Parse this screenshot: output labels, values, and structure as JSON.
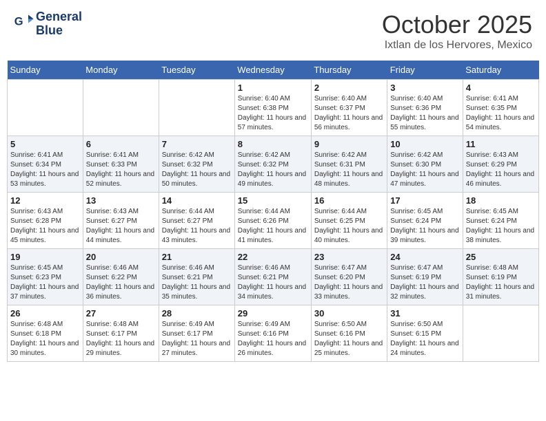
{
  "header": {
    "logo_line1": "General",
    "logo_line2": "Blue",
    "month": "October 2025",
    "location": "Ixtlan de los Hervores, Mexico"
  },
  "days_of_week": [
    "Sunday",
    "Monday",
    "Tuesday",
    "Wednesday",
    "Thursday",
    "Friday",
    "Saturday"
  ],
  "weeks": [
    [
      {
        "day": "",
        "sunrise": "",
        "sunset": "",
        "daylight": ""
      },
      {
        "day": "",
        "sunrise": "",
        "sunset": "",
        "daylight": ""
      },
      {
        "day": "",
        "sunrise": "",
        "sunset": "",
        "daylight": ""
      },
      {
        "day": "1",
        "sunrise": "Sunrise: 6:40 AM",
        "sunset": "Sunset: 6:38 PM",
        "daylight": "Daylight: 11 hours and 57 minutes."
      },
      {
        "day": "2",
        "sunrise": "Sunrise: 6:40 AM",
        "sunset": "Sunset: 6:37 PM",
        "daylight": "Daylight: 11 hours and 56 minutes."
      },
      {
        "day": "3",
        "sunrise": "Sunrise: 6:40 AM",
        "sunset": "Sunset: 6:36 PM",
        "daylight": "Daylight: 11 hours and 55 minutes."
      },
      {
        "day": "4",
        "sunrise": "Sunrise: 6:41 AM",
        "sunset": "Sunset: 6:35 PM",
        "daylight": "Daylight: 11 hours and 54 minutes."
      }
    ],
    [
      {
        "day": "5",
        "sunrise": "Sunrise: 6:41 AM",
        "sunset": "Sunset: 6:34 PM",
        "daylight": "Daylight: 11 hours and 53 minutes."
      },
      {
        "day": "6",
        "sunrise": "Sunrise: 6:41 AM",
        "sunset": "Sunset: 6:33 PM",
        "daylight": "Daylight: 11 hours and 52 minutes."
      },
      {
        "day": "7",
        "sunrise": "Sunrise: 6:42 AM",
        "sunset": "Sunset: 6:32 PM",
        "daylight": "Daylight: 11 hours and 50 minutes."
      },
      {
        "day": "8",
        "sunrise": "Sunrise: 6:42 AM",
        "sunset": "Sunset: 6:32 PM",
        "daylight": "Daylight: 11 hours and 49 minutes."
      },
      {
        "day": "9",
        "sunrise": "Sunrise: 6:42 AM",
        "sunset": "Sunset: 6:31 PM",
        "daylight": "Daylight: 11 hours and 48 minutes."
      },
      {
        "day": "10",
        "sunrise": "Sunrise: 6:42 AM",
        "sunset": "Sunset: 6:30 PM",
        "daylight": "Daylight: 11 hours and 47 minutes."
      },
      {
        "day": "11",
        "sunrise": "Sunrise: 6:43 AM",
        "sunset": "Sunset: 6:29 PM",
        "daylight": "Daylight: 11 hours and 46 minutes."
      }
    ],
    [
      {
        "day": "12",
        "sunrise": "Sunrise: 6:43 AM",
        "sunset": "Sunset: 6:28 PM",
        "daylight": "Daylight: 11 hours and 45 minutes."
      },
      {
        "day": "13",
        "sunrise": "Sunrise: 6:43 AM",
        "sunset": "Sunset: 6:27 PM",
        "daylight": "Daylight: 11 hours and 44 minutes."
      },
      {
        "day": "14",
        "sunrise": "Sunrise: 6:44 AM",
        "sunset": "Sunset: 6:27 PM",
        "daylight": "Daylight: 11 hours and 43 minutes."
      },
      {
        "day": "15",
        "sunrise": "Sunrise: 6:44 AM",
        "sunset": "Sunset: 6:26 PM",
        "daylight": "Daylight: 11 hours and 41 minutes."
      },
      {
        "day": "16",
        "sunrise": "Sunrise: 6:44 AM",
        "sunset": "Sunset: 6:25 PM",
        "daylight": "Daylight: 11 hours and 40 minutes."
      },
      {
        "day": "17",
        "sunrise": "Sunrise: 6:45 AM",
        "sunset": "Sunset: 6:24 PM",
        "daylight": "Daylight: 11 hours and 39 minutes."
      },
      {
        "day": "18",
        "sunrise": "Sunrise: 6:45 AM",
        "sunset": "Sunset: 6:24 PM",
        "daylight": "Daylight: 11 hours and 38 minutes."
      }
    ],
    [
      {
        "day": "19",
        "sunrise": "Sunrise: 6:45 AM",
        "sunset": "Sunset: 6:23 PM",
        "daylight": "Daylight: 11 hours and 37 minutes."
      },
      {
        "day": "20",
        "sunrise": "Sunrise: 6:46 AM",
        "sunset": "Sunset: 6:22 PM",
        "daylight": "Daylight: 11 hours and 36 minutes."
      },
      {
        "day": "21",
        "sunrise": "Sunrise: 6:46 AM",
        "sunset": "Sunset: 6:21 PM",
        "daylight": "Daylight: 11 hours and 35 minutes."
      },
      {
        "day": "22",
        "sunrise": "Sunrise: 6:46 AM",
        "sunset": "Sunset: 6:21 PM",
        "daylight": "Daylight: 11 hours and 34 minutes."
      },
      {
        "day": "23",
        "sunrise": "Sunrise: 6:47 AM",
        "sunset": "Sunset: 6:20 PM",
        "daylight": "Daylight: 11 hours and 33 minutes."
      },
      {
        "day": "24",
        "sunrise": "Sunrise: 6:47 AM",
        "sunset": "Sunset: 6:19 PM",
        "daylight": "Daylight: 11 hours and 32 minutes."
      },
      {
        "day": "25",
        "sunrise": "Sunrise: 6:48 AM",
        "sunset": "Sunset: 6:19 PM",
        "daylight": "Daylight: 11 hours and 31 minutes."
      }
    ],
    [
      {
        "day": "26",
        "sunrise": "Sunrise: 6:48 AM",
        "sunset": "Sunset: 6:18 PM",
        "daylight": "Daylight: 11 hours and 30 minutes."
      },
      {
        "day": "27",
        "sunrise": "Sunrise: 6:48 AM",
        "sunset": "Sunset: 6:17 PM",
        "daylight": "Daylight: 11 hours and 29 minutes."
      },
      {
        "day": "28",
        "sunrise": "Sunrise: 6:49 AM",
        "sunset": "Sunset: 6:17 PM",
        "daylight": "Daylight: 11 hours and 27 minutes."
      },
      {
        "day": "29",
        "sunrise": "Sunrise: 6:49 AM",
        "sunset": "Sunset: 6:16 PM",
        "daylight": "Daylight: 11 hours and 26 minutes."
      },
      {
        "day": "30",
        "sunrise": "Sunrise: 6:50 AM",
        "sunset": "Sunset: 6:16 PM",
        "daylight": "Daylight: 11 hours and 25 minutes."
      },
      {
        "day": "31",
        "sunrise": "Sunrise: 6:50 AM",
        "sunset": "Sunset: 6:15 PM",
        "daylight": "Daylight: 11 hours and 24 minutes."
      },
      {
        "day": "",
        "sunrise": "",
        "sunset": "",
        "daylight": ""
      }
    ]
  ]
}
